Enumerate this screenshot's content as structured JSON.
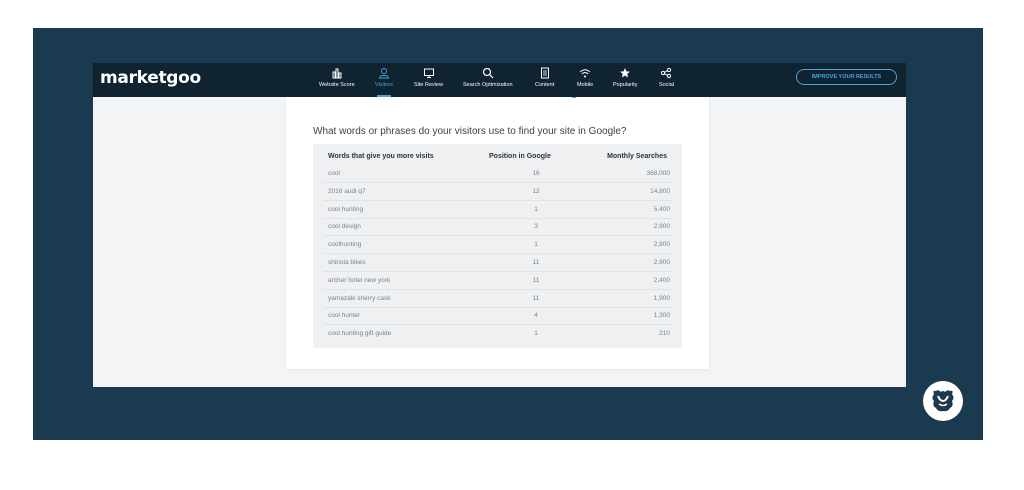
{
  "app": {
    "logo": "marketgoo",
    "nav": [
      {
        "label": "Website Score",
        "icon": "bar-chart-icon"
      },
      {
        "label": "Visitors",
        "icon": "user-icon",
        "active": true
      },
      {
        "label": "Site Review",
        "icon": "monitor-icon"
      },
      {
        "label": "Search Optimization",
        "icon": "search-icon"
      },
      {
        "label": "Content",
        "icon": "document-icon"
      },
      {
        "label": "Mobile",
        "icon": "wifi-icon"
      },
      {
        "label": "Popularity",
        "icon": "star-icon"
      },
      {
        "label": "Social",
        "icon": "share-icon"
      }
    ],
    "improve_button": "IMPROVE YOUR RESULTS"
  },
  "main": {
    "question": "What words or phrases do your visitors use to find your site in Google?",
    "table": {
      "headers": [
        "Words that give you more visits",
        "Position in Google",
        "Monthly Searches"
      ],
      "rows": [
        [
          "cool",
          "16",
          "368,000"
        ],
        [
          "2016 audi q7",
          "12",
          "14,800"
        ],
        [
          "cool hunting",
          "1",
          "5,400"
        ],
        [
          "cool design",
          "3",
          "2,900"
        ],
        [
          "coolhunting",
          "1",
          "2,900"
        ],
        [
          "shinola bikes",
          "11",
          "2,900"
        ],
        [
          "archer hotel new york",
          "11",
          "2,400"
        ],
        [
          "yamazaki sherry cask",
          "11",
          "1,900"
        ],
        [
          "cool hunter",
          "4",
          "1,300"
        ],
        [
          "cool hunting gift guide",
          "1",
          "210"
        ]
      ]
    }
  },
  "colors": {
    "frame": "#1b3a4f",
    "topbar": "#0f2330",
    "accent": "#4aa3df"
  },
  "badge_icon": "monster-logo-icon"
}
